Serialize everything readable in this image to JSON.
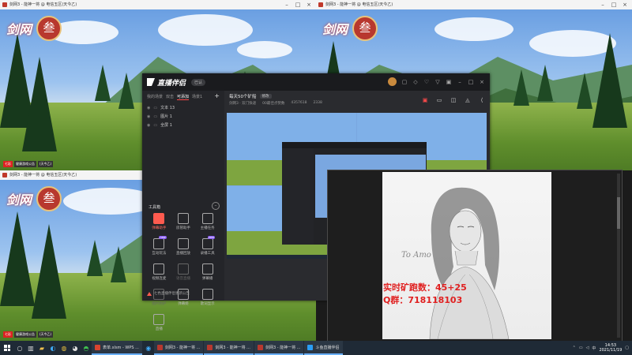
{
  "game_windows": [
    {
      "id": "top-left",
      "title": "剑网3 - 能神一将 @ 电信五区(天今乙)"
    },
    {
      "id": "top-right",
      "title": "剑网3 - 能神一将 @ 电信五区(天今乙)"
    },
    {
      "id": "bottom-left",
      "title": "剑网3 - 能神一将 @ 电信五区(天今乙)"
    }
  ],
  "game_logo_text": "剑网",
  "game_logo_seal": "叁",
  "game_footer": [
    "七彩",
    "健康游戏公告",
    "(天今乙)"
  ],
  "helper": {
    "brand": "直播伴侣",
    "version": "已认",
    "scene_tabs": [
      "我的场景",
      "双击",
      "可添加",
      "场景1"
    ],
    "active_scene_tab": 2,
    "sources": [
      {
        "name": "文本 13"
      },
      {
        "name": "图片 1"
      },
      {
        "name": "全屏 1"
      }
    ],
    "tools_title": "工具箱",
    "tools": [
      {
        "label": "弹幕助手",
        "style": "red"
      },
      {
        "label": "房管助手",
        "style": "normal"
      },
      {
        "label": "主播任务",
        "style": "normal"
      },
      {
        "label": "互动玩法",
        "style": "normal",
        "badge": "new"
      },
      {
        "label": "直播回放",
        "style": "normal"
      },
      {
        "label": "录播工具",
        "style": "normal",
        "badge": "new"
      },
      {
        "label": "视频连麦",
        "style": "normal"
      },
      {
        "label": "语音直播",
        "style": "dim"
      },
      {
        "label": "弹幕播",
        "style": "normal"
      },
      {
        "label": "图片防护",
        "style": "dim"
      },
      {
        "label": "弹幕姬",
        "style": "normal"
      },
      {
        "label": "歌词显示",
        "style": "normal"
      },
      {
        "label": "直播",
        "style": "normal"
      }
    ],
    "announcement": "七色直播伴侣更新公告",
    "room_title": "每天50个矿船",
    "room_edit": "修改",
    "room_meta": [
      "剑网3 · 双门快递",
      "00最佳点赞数",
      "4357618",
      "2338"
    ],
    "bottom_actions": [
      "直播屏幕",
      "摄像头"
    ]
  },
  "sketch_text": "To Amo",
  "overlay": {
    "line1": "实时矿跑数：45+25",
    "line2": "Q群：718118103"
  },
  "taskbar": {
    "apps": [
      {
        "label": "表单.xlsm - WPS ...",
        "color": "#d9432f"
      },
      {
        "label": "剑网3 - 能神一将 ...",
        "color": "#b8382e"
      },
      {
        "label": "剑网3 - 能神一将 ...",
        "color": "#b8382e"
      },
      {
        "label": "剑网3 - 能神一将 ...",
        "color": "#b8382e"
      },
      {
        "label": "斗鱼直播伴侣",
        "color": "#2a9df4"
      }
    ],
    "time": "14:53",
    "date": "2021/11/19"
  }
}
